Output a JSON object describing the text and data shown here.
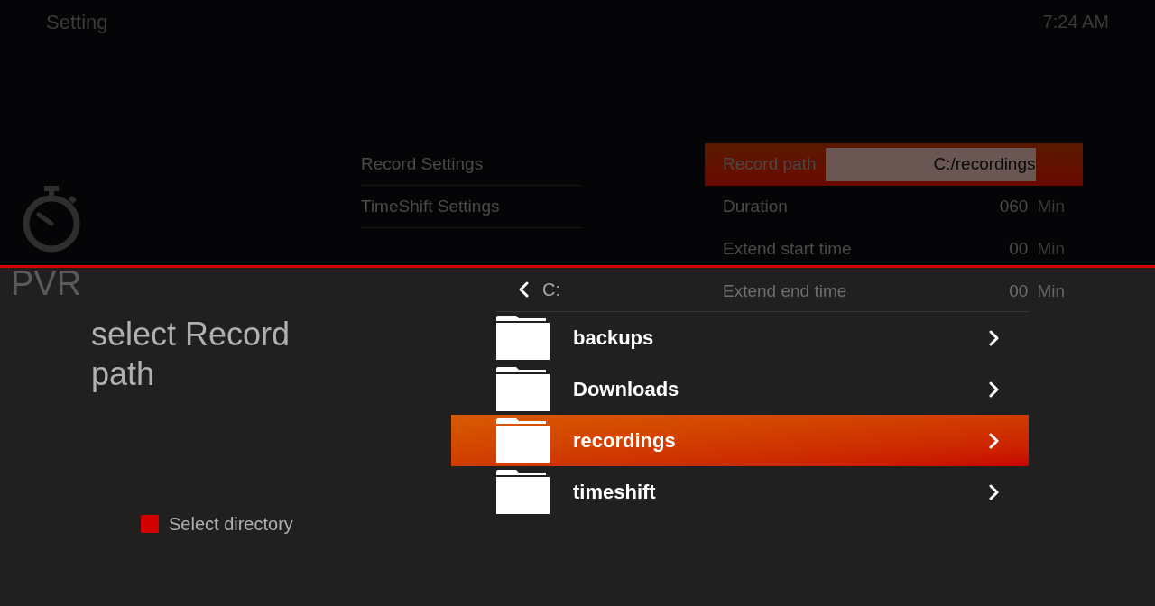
{
  "header": {
    "title": "Setting",
    "time": "7:24 AM"
  },
  "app_label": "PVR",
  "settings_menu": [
    {
      "label": "Record Settings"
    },
    {
      "label": "TimeShift Settings"
    }
  ],
  "settings_rows": [
    {
      "kind": "path",
      "label": "Record path",
      "value": "C:/recordings",
      "selected": true
    },
    {
      "kind": "number",
      "label": "Duration",
      "value": "060",
      "unit": "Min",
      "selected": false
    },
    {
      "kind": "number",
      "label": "Extend start time",
      "value": "00",
      "unit": "Min",
      "selected": false
    },
    {
      "kind": "number",
      "label": "Extend end time",
      "value": "00",
      "unit": "Min",
      "selected": false
    }
  ],
  "dialog": {
    "title": "select Record path",
    "legend": {
      "label": "Select directory",
      "color": "#d40000"
    },
    "current_dir": "C:",
    "folders": [
      {
        "name": "backups",
        "selected": false
      },
      {
        "name": "Downloads",
        "selected": false
      },
      {
        "name": "recordings",
        "selected": true
      },
      {
        "name": "timeshift",
        "selected": false
      }
    ]
  }
}
